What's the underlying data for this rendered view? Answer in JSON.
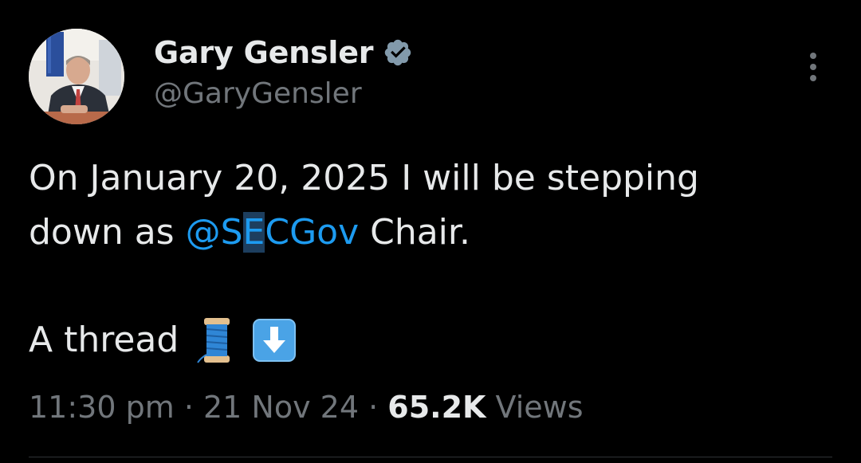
{
  "author": {
    "display_name": "Gary Gensler",
    "handle": "@GaryGensler",
    "verified_icon": "verified-badge-icon",
    "avatar_icon": "profile-photo"
  },
  "menu": {
    "icon": "more-options-icon"
  },
  "tweet": {
    "line1": "On January 20, 2025 I will be stepping",
    "line2_prefix": "down as ",
    "mention_part1": "@S",
    "mention_selected": "E",
    "mention_part2": "CGov",
    "line2_suffix": " Chair.",
    "thread_text": "A thread",
    "emojis": [
      "spool-of-thread-icon",
      "down-arrow-icon"
    ]
  },
  "meta": {
    "time": "11:30 pm",
    "sep1": " · ",
    "date": "21 Nov 24",
    "sep2": " · ",
    "views_count": "65.2K",
    "views_label": " Views"
  },
  "colors": {
    "background": "#000000",
    "text_primary": "#e7e9ea",
    "text_secondary": "#71767b",
    "accent": "#1d9bf0"
  }
}
